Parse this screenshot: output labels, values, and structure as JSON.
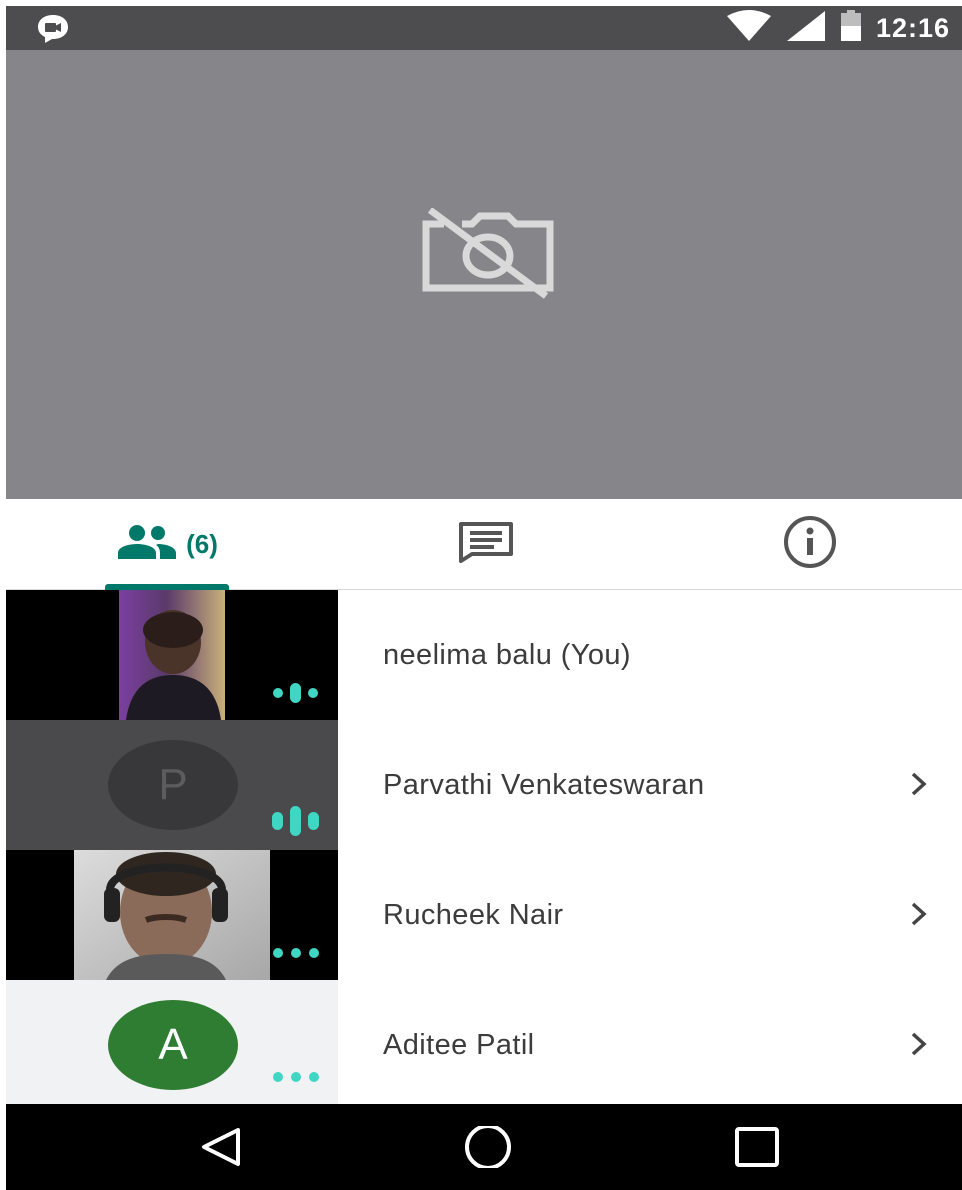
{
  "status_bar": {
    "time": "12:16",
    "app_icon": "meet-chat-icon",
    "icons": [
      "wifi-icon",
      "cellular-signal-icon",
      "battery-icon"
    ]
  },
  "video": {
    "icon": "camera-off-icon",
    "background": "#868589"
  },
  "tabs": {
    "people_count": "(6)",
    "people_icon": "people-icon",
    "chat_icon": "chat-message-icon",
    "info_icon": "info-icon",
    "active": "people",
    "accent": "#00796b"
  },
  "participants": [
    {
      "name": "neelima balu (You)",
      "thumb": "video",
      "indicator": "speaking",
      "has_chevron": false
    },
    {
      "name": "Parvathi Venkateswaran",
      "thumb": "avatar",
      "avatar_letter": "P",
      "indicator": "speaking",
      "has_chevron": true
    },
    {
      "name": "Rucheek Nair",
      "thumb": "video",
      "indicator": "muted-dots",
      "has_chevron": true
    },
    {
      "name": "Aditee Patil",
      "thumb": "avatar",
      "avatar_letter": "A",
      "indicator": "muted-dots",
      "has_chevron": true
    }
  ],
  "colors": {
    "indicator": "#3fd6c4",
    "avatar_green": "#2e7d32",
    "avatar_dark": "#3a3a3c"
  },
  "nav_bar": {
    "buttons": [
      "back-icon",
      "home-icon",
      "recents-icon"
    ]
  }
}
